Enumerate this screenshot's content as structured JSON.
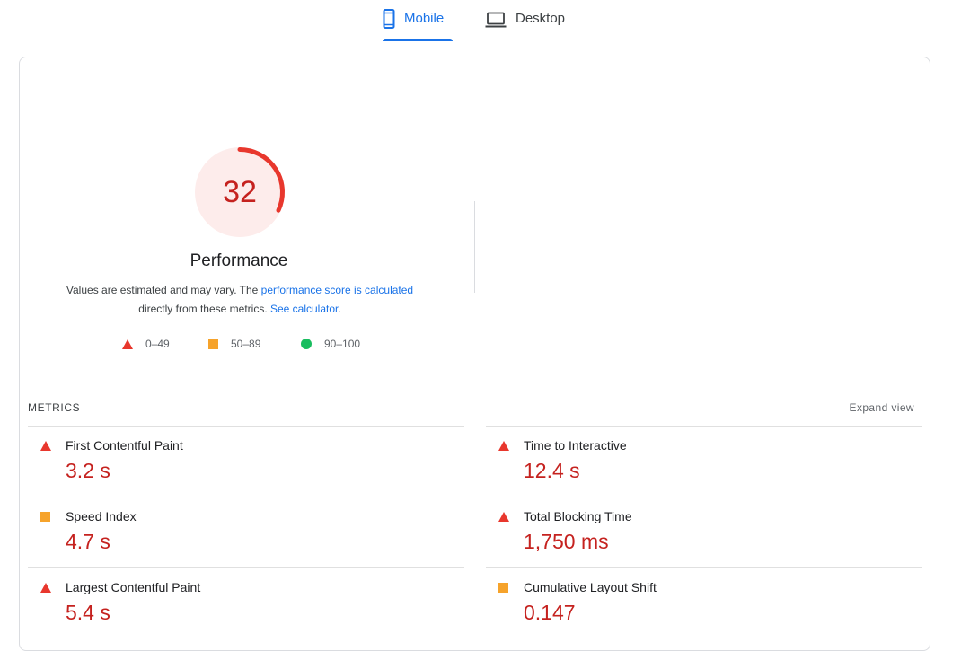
{
  "tabs": {
    "mobile": {
      "label": "Mobile",
      "icon": "mobile-phone-icon",
      "active": true
    },
    "desktop": {
      "label": "Desktop",
      "icon": "laptop-icon",
      "active": false
    }
  },
  "performance": {
    "score": "32",
    "score_fraction": 0.32,
    "title": "Performance",
    "note_prefix": "Values are estimated and may vary. The ",
    "note_link1": "performance score is calculated",
    "note_middle": " directly from these metrics. ",
    "note_link2": "See calculator",
    "note_suffix": ".",
    "colors": {
      "fail": "#e8372d",
      "fail_text": "#c5221f",
      "fail_bg": "#fdeceb"
    }
  },
  "legend": [
    {
      "range": "0–49",
      "shape": "triangle",
      "color": "#e8372d"
    },
    {
      "range": "50–89",
      "shape": "square",
      "color": "#f6a32b"
    },
    {
      "range": "90–100",
      "shape": "circle",
      "color": "#19bd5f"
    }
  ],
  "metrics": {
    "header": "METRICS",
    "expand_label": "Expand view",
    "left": [
      {
        "name": "First Contentful Paint",
        "value": "3.2 s",
        "status": "fail"
      },
      {
        "name": "Speed Index",
        "value": "4.7 s",
        "status": "average"
      },
      {
        "name": "Largest Contentful Paint",
        "value": "5.4 s",
        "status": "fail"
      }
    ],
    "right": [
      {
        "name": "Time to Interactive",
        "value": "12.4 s",
        "status": "fail"
      },
      {
        "name": "Total Blocking Time",
        "value": "1,750 ms",
        "status": "fail"
      },
      {
        "name": "Cumulative Layout Shift",
        "value": "0.147",
        "status": "average"
      }
    ]
  }
}
